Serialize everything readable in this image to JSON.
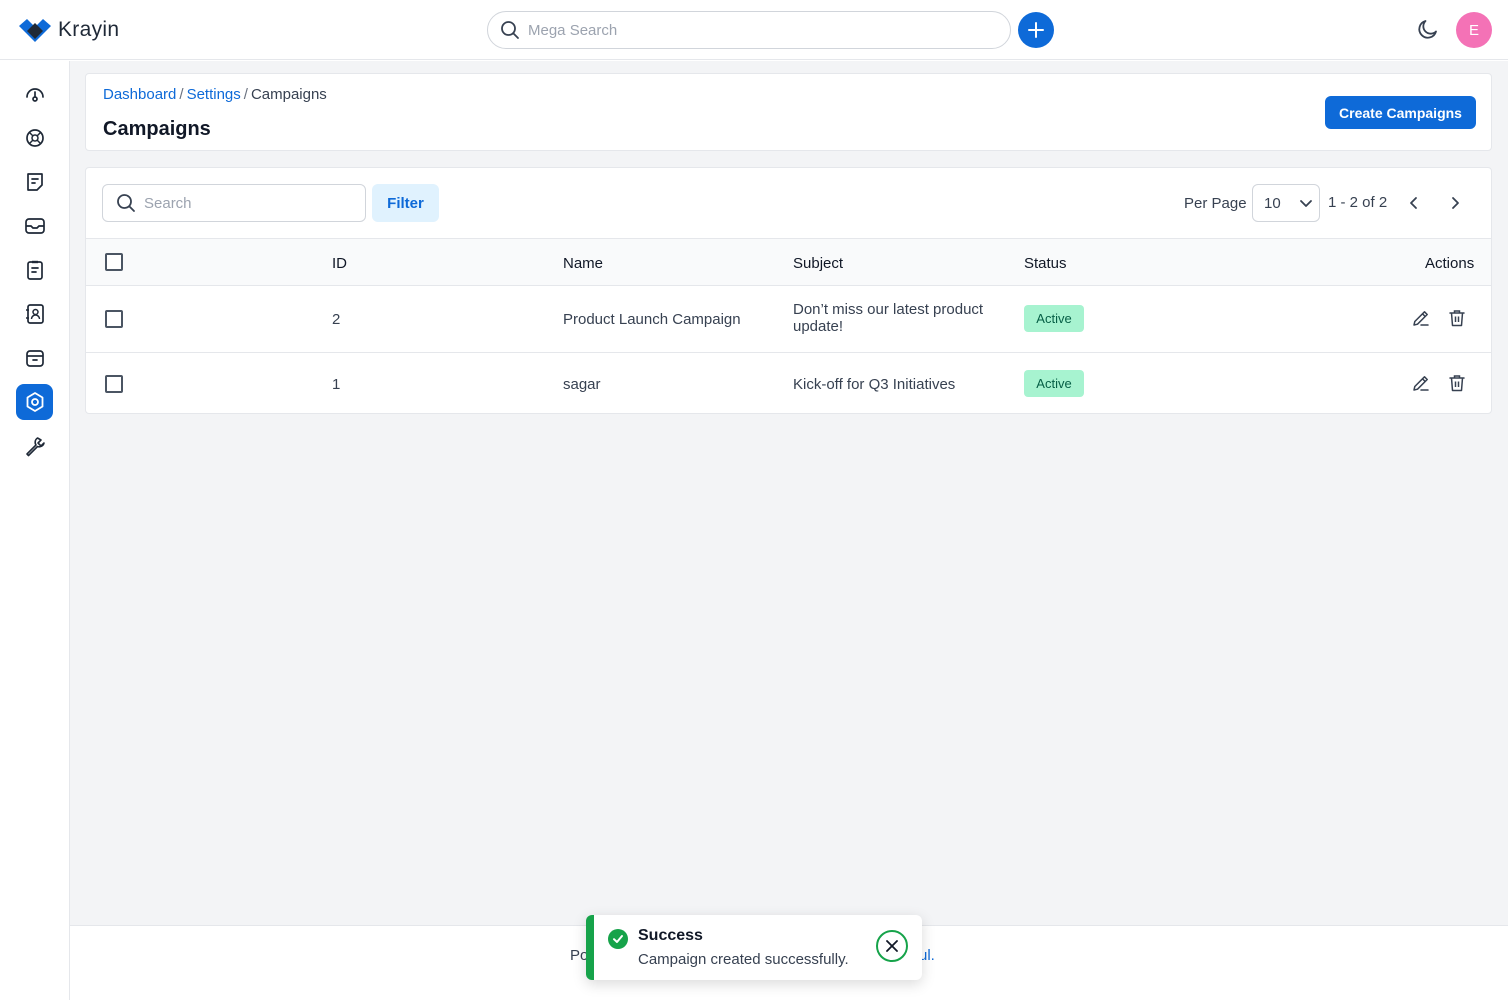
{
  "header": {
    "brand": "Krayin",
    "search_placeholder": "Mega Search",
    "avatar_initial": "E"
  },
  "sidebar": {
    "items": [
      {
        "name": "dashboard",
        "icon": "dashboard-icon",
        "active": false
      },
      {
        "name": "leads",
        "icon": "leads-icon",
        "active": false
      },
      {
        "name": "quotes",
        "icon": "quotes-icon",
        "active": false
      },
      {
        "name": "mail",
        "icon": "mail-icon",
        "active": false
      },
      {
        "name": "activities",
        "icon": "activities-icon",
        "active": false
      },
      {
        "name": "contacts",
        "icon": "contacts-icon",
        "active": false
      },
      {
        "name": "products",
        "icon": "products-icon",
        "active": false
      },
      {
        "name": "settings",
        "icon": "settings-icon",
        "active": true
      },
      {
        "name": "configuration",
        "icon": "wrench-icon",
        "active": false
      }
    ]
  },
  "breadcrumb": {
    "items": [
      "Dashboard",
      "Settings",
      "Campaigns"
    ],
    "separator": "/"
  },
  "page": {
    "title": "Campaigns",
    "create_button": "Create Campaigns"
  },
  "grid": {
    "search_placeholder": "Search",
    "filter_label": "Filter",
    "per_page_label": "Per Page",
    "per_page_value": "10",
    "pagination_info": "1 - 2 of 2",
    "columns": [
      "ID",
      "Name",
      "Subject",
      "Status",
      "Actions"
    ],
    "rows": [
      {
        "id": "2",
        "name": "Product Launch Campaign",
        "subject_line1": "Don’t miss our latest product",
        "subject_line2": "update!",
        "status": "Active"
      },
      {
        "id": "1",
        "name": "sagar",
        "subject_line1": "Kick-off for Q3 Initiatives",
        "subject_line2": "",
        "status": "Active"
      }
    ]
  },
  "footer": {
    "left_fragment": "Po",
    "right_fragment": "ul."
  },
  "toast": {
    "title": "Success",
    "message": "Campaign created successfully."
  },
  "colors": {
    "primary": "#0e6ad8",
    "success": "#16a34a",
    "badge_bg": "#a7f3d0",
    "avatar_bg": "#f472b6"
  }
}
